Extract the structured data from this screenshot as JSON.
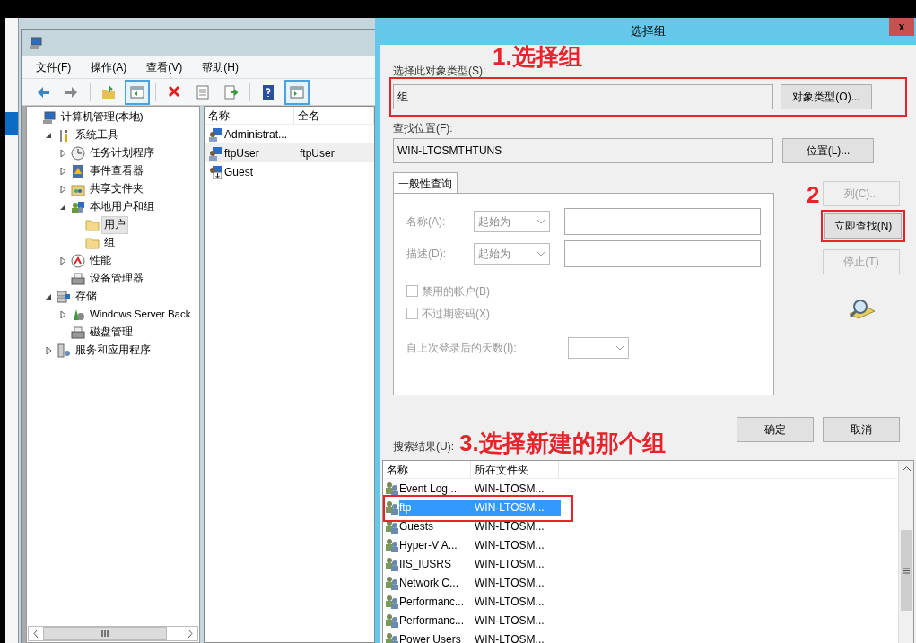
{
  "mmc": {
    "menu": [
      "文件(F)",
      "操作(A)",
      "查看(V)",
      "帮助(H)"
    ],
    "toolbar": [
      {
        "kind": "back",
        "selected": false
      },
      {
        "kind": "forward",
        "selected": false
      },
      {
        "kind": "sep"
      },
      {
        "kind": "up",
        "selected": false
      },
      {
        "kind": "tree",
        "selected": true
      },
      {
        "kind": "sep"
      },
      {
        "kind": "delete",
        "selected": false
      },
      {
        "kind": "properties",
        "selected": false
      },
      {
        "kind": "export",
        "selected": false
      },
      {
        "kind": "sep"
      },
      {
        "kind": "help",
        "selected": false
      },
      {
        "kind": "pane",
        "selected": true
      }
    ],
    "tree": [
      {
        "label": "计算机管理(本地)",
        "kind": "computer",
        "selected": false,
        "children": [
          {
            "label": "系统工具",
            "kind": "tools",
            "expanded": true,
            "selected": false,
            "children": [
              {
                "label": "任务计划程序",
                "kind": "clock",
                "expanded": false,
                "selected": false
              },
              {
                "label": "事件查看器",
                "kind": "log",
                "expanded": false,
                "selected": false
              },
              {
                "label": "共享文件夹",
                "kind": "share",
                "expanded": false,
                "selected": false
              },
              {
                "label": "本地用户和组",
                "kind": "users",
                "expanded": true,
                "selected": false,
                "children": [
                  {
                    "label": "用户",
                    "kind": "folder",
                    "selected": true
                  },
                  {
                    "label": "组",
                    "kind": "folder",
                    "selected": false
                  }
                ]
              },
              {
                "label": "性能",
                "kind": "gauge",
                "expanded": false,
                "selected": false
              },
              {
                "label": "设备管理器",
                "kind": "device",
                "selected": false
              }
            ]
          },
          {
            "label": "存储",
            "kind": "storage",
            "expanded": true,
            "selected": false,
            "children": [
              {
                "label": "Windows Server Back",
                "kind": "backup",
                "expanded": false,
                "selected": false
              },
              {
                "label": "磁盘管理",
                "kind": "device",
                "selected": false
              }
            ]
          },
          {
            "label": "服务和应用程序",
            "kind": "services",
            "expanded": false,
            "selected": false
          }
        ]
      }
    ],
    "list": {
      "columns": [
        "名称",
        "全名"
      ],
      "rows": [
        {
          "kind": "user",
          "name": "Administrat...",
          "selected": false
        },
        {
          "kind": "user",
          "name": "ftpUser",
          "full_name": "ftpUser",
          "selected": true
        },
        {
          "kind": "user-disabled",
          "name": "Guest",
          "selected": false
        }
      ]
    }
  },
  "dialog": {
    "title": "选择组",
    "close": "x",
    "object_type": {
      "label": "选择此对象类型(S):",
      "value": "组",
      "button": "对象类型(O)..."
    },
    "location": {
      "label": "查找位置(F):",
      "value": "WIN-LTOSMTHTUNS",
      "button": "位置(L)..."
    },
    "tab": "一般性查询",
    "query": {
      "fields": [
        {
          "label": "名称(A):",
          "operator": "起始为"
        },
        {
          "label": "描述(D):",
          "operator": "起始为"
        }
      ],
      "checkboxes": [
        {
          "label": "禁用的帐户(B)",
          "checked": false
        },
        {
          "label": "不过期密码(X)",
          "checked": false
        }
      ],
      "days_label": "自上次登录后的天数(I):"
    },
    "side_buttons": [
      {
        "label": "列(C)...",
        "disabled": true
      },
      {
        "label": "立即查找(N)",
        "disabled": false
      },
      {
        "label": "停止(T)",
        "disabled": true
      }
    ],
    "ok": "确定",
    "cancel": "取消",
    "results_label": "搜索结果(U):",
    "results": {
      "columns": [
        "名称",
        "所在文件夹"
      ],
      "rows": [
        {
          "name": "Event Log ...",
          "folder": "WIN-LTOSM...",
          "selected": false
        },
        {
          "name": "ftp",
          "folder": "WIN-LTOSM...",
          "selected": true
        },
        {
          "name": "Guests",
          "folder": "WIN-LTOSM...",
          "selected": false
        },
        {
          "name": "Hyper-V A...",
          "folder": "WIN-LTOSM...",
          "selected": false
        },
        {
          "name": "IIS_IUSRS",
          "folder": "WIN-LTOSM...",
          "selected": false
        },
        {
          "name": "Network C...",
          "folder": "WIN-LTOSM...",
          "selected": false
        },
        {
          "name": "Performanc...",
          "folder": "WIN-LTOSM...",
          "selected": false
        },
        {
          "name": "Performanc...",
          "folder": "WIN-LTOSM...",
          "selected": false
        },
        {
          "name": "Power Users",
          "folder": "WIN-LTOSM...",
          "selected": false
        }
      ]
    }
  },
  "annotations": [
    "1.选择组",
    "2",
    "3.选择新建的那个组"
  ]
}
